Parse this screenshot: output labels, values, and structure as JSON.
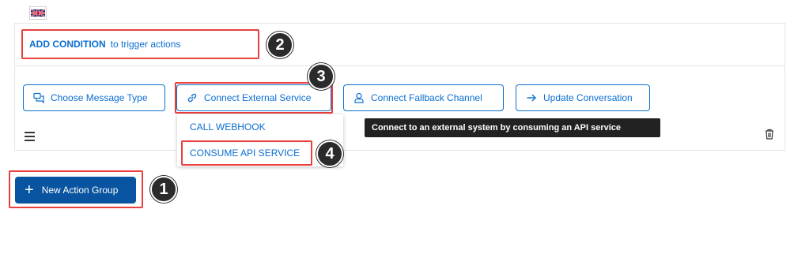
{
  "condition": {
    "strong": "ADD CONDITION",
    "rest": "to trigger actions"
  },
  "actions": {
    "choose_message_type": "Choose Message Type",
    "connect_external_service": "Connect External Service",
    "connect_fallback_channel": "Connect Fallback Channel",
    "update_conversation": "Update Conversation"
  },
  "dropdown": {
    "items": [
      "CALL WEBHOOK",
      "CONSUME API SERVICE"
    ]
  },
  "tooltip": "Connect to an external system by consuming an API service",
  "new_action_group": {
    "plus": "+",
    "label": "New Action Group"
  },
  "badges": [
    "1",
    "2",
    "3",
    "4"
  ],
  "icons": {
    "flag": "uk-flag-icon",
    "message": "message-icon",
    "link": "link-icon",
    "person": "person-icon",
    "arrow": "arrow-right-icon",
    "menu": "hamburger-icon",
    "delete": "trash-icon"
  },
  "colors": {
    "accent": "#0a6ed1",
    "primary": "#0854a0",
    "highlight": "#e9403e",
    "badge": "#2b2b2b",
    "tooltip_bg": "#222222"
  }
}
